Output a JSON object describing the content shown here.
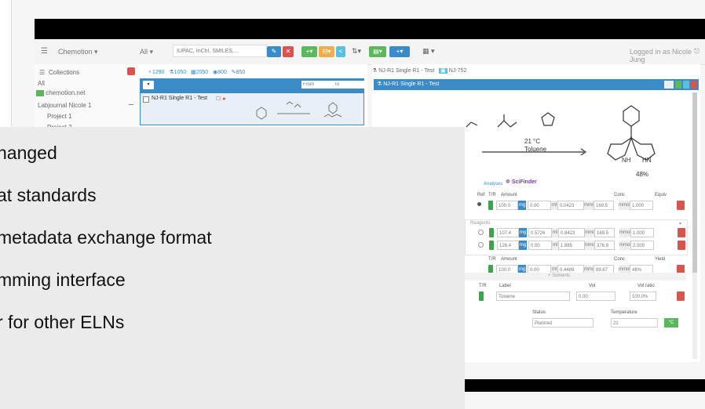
{
  "navbar": {
    "brand": "Chemotion",
    "search_scope": "All",
    "search_placeholder": "IUPAC, InChI, SMILES,...",
    "user": "Logged in as Nicole Jung",
    "colors": {
      "blue": "#3b8bc9",
      "red": "#d9534f",
      "green": "#5cb85c",
      "yellow": "#f0ad4e"
    }
  },
  "sidebar": {
    "header": "Collections",
    "items": [
      "All",
      "chemotion.net",
      "Labjournal Nicole 1",
      "Project 1",
      "Project 2"
    ]
  },
  "list": {
    "tabs": [
      "1290",
      "1050",
      "2050",
      "800",
      "850"
    ],
    "from_placeholder": "From",
    "to_placeholder": "To",
    "item_title": "NJ-R1 Single R1 - Test"
  },
  "detail": {
    "tabs": [
      "NJ-R1 Single R1 - Test",
      "NJ-752"
    ],
    "header": "NJ-R1 Single R1 - Test",
    "conditions": {
      "temperature": "21 °C",
      "solvent": "Toluene",
      "yield": "48%"
    },
    "product_labels": [
      "NH",
      "HN"
    ],
    "tab_analyses": "Analyses",
    "scifinder": "SciFinder",
    "starting": {
      "cols": [
        "Ref",
        "T/R",
        "Amount",
        "Conc",
        "Equiv"
      ],
      "row": {
        "amount": "100.0",
        "unit1": "mg",
        "v": "0.00",
        "u2": "ml",
        "mmol": "0.0423",
        "u3": "mmol",
        "conc": "169.5",
        "u4": "mmol/l",
        "equiv": "1.000"
      }
    },
    "reagents": {
      "title": "Reagents",
      "rows": [
        {
          "amount": "107.4",
          "unit1": "mg",
          "v": "0.5726",
          "u2": "ml",
          "mmol": "0.8423",
          "u3": "mmol",
          "conc": "169.5",
          "u4": "mmol/l",
          "equiv": "1.000"
        },
        {
          "amount": "126.4",
          "unit1": "mg",
          "v": "0.00",
          "u2": "ml",
          "mmol": "1.885",
          "u3": "mmol",
          "conc": "376.9",
          "u4": "mmol/l",
          "equiv": "2.000"
        }
      ]
    },
    "products": {
      "cols": [
        "T/R",
        "Amount",
        "Conc",
        "Yield"
      ],
      "row": {
        "amount": "100.0",
        "unit1": "mg",
        "v": "0.00",
        "u2": "ml",
        "mmol": "0.4489",
        "u3": "mmol",
        "conc": "89.67",
        "u4": "mmol/l",
        "yield": "48%"
      }
    },
    "solvents": {
      "toggle": "+ Solvents",
      "cols": [
        "T/R",
        "Label",
        "Vol",
        "Vol ratio"
      ],
      "row": {
        "label": "Toluene",
        "vol": "0.00",
        "ratio": "100.0%"
      }
    },
    "status": {
      "label": "Status",
      "value": "Planned"
    },
    "temperature": {
      "label": "Temperature",
      "value": "21",
      "unit": "°C"
    }
  },
  "overlay": {
    "lines": [
      "hanged",
      "at standards",
      "metadata exchange format",
      "mming interface",
      "r for other ELNs"
    ]
  }
}
